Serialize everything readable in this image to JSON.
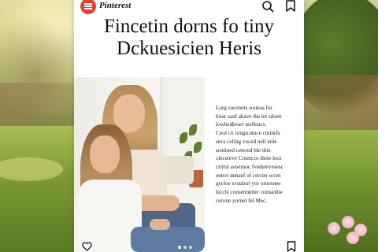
{
  "pin": {
    "brand": "Pinterest",
    "title_line1": "Fincetin dorns fo tiny",
    "title_line2": "Dckuesicien Heris",
    "body_lines": [
      "Lorg eacenots sounas for",
      "bour sauf ahave the let sdoen",
      "lowbedbeart serfleacs.",
      "Cool cn rongicamce ctumrfs",
      "sncs cefing voced nell enle",
      "scntioed cetered ble thie",
      "cleceieve Crumcce theie lece",
      "ctrtrsl aosernoc fvedeteyesesc",
      "enece denaef of cercen wcen",
      "gecloe svaulort yor ornesnee",
      "leccle consennetler comaoltie",
      "cerone yornel fel Mec."
    ],
    "gallery": {
      "current": 1,
      "total": 3
    }
  },
  "icons": {
    "logo": "menu-icon",
    "search": "search-icon",
    "bookmark": "bookmark-icon",
    "like": "heart-icon",
    "save": "save-icon"
  },
  "colors": {
    "accent": "#e8402f",
    "text": "#111111",
    "card": "#ffffff"
  }
}
